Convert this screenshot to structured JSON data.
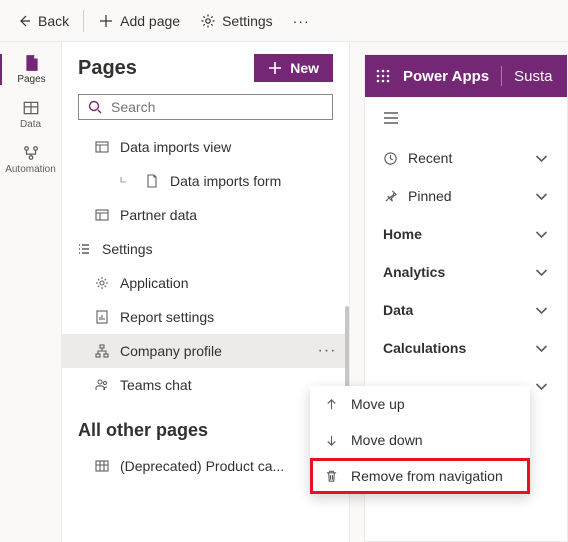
{
  "toolbar": {
    "back": "Back",
    "add_page": "Add page",
    "settings": "Settings"
  },
  "rail": {
    "pages": "Pages",
    "data": "Data",
    "automation": "Automation"
  },
  "panel": {
    "title": "Pages",
    "new_label": "New",
    "search_placeholder": "Search",
    "tree": {
      "data_imports_view": "Data imports view",
      "data_imports_form": "Data imports form",
      "partner_data": "Partner data",
      "settings": "Settings",
      "application": "Application",
      "report_settings": "Report settings",
      "company_profile": "Company profile",
      "teams_chat": "Teams chat"
    },
    "other_header": "All other pages",
    "other_item": "(Deprecated) Product ca..."
  },
  "preview": {
    "brand": "Power Apps",
    "app": "Susta",
    "recent": "Recent",
    "pinned": "Pinned",
    "home": "Home",
    "analytics": "Analytics",
    "data": "Data",
    "calculations": "Calculations"
  },
  "context": {
    "move_up": "Move up",
    "move_down": "Move down",
    "remove": "Remove from navigation"
  }
}
